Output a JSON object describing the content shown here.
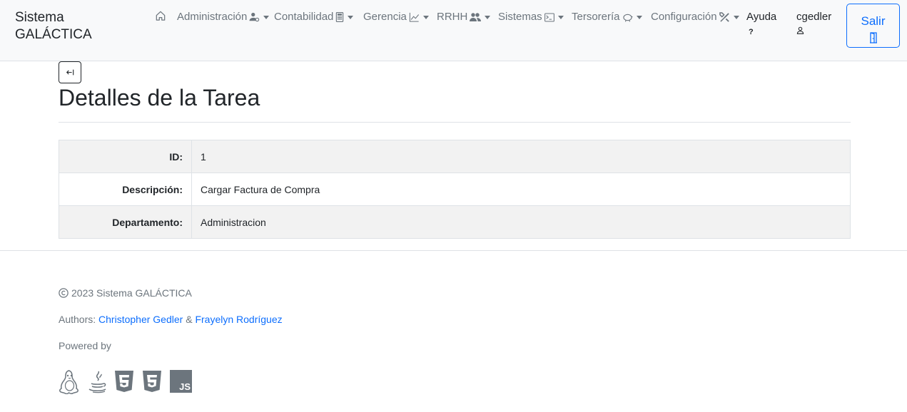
{
  "app": {
    "brand": "Sistema GALÁCTICA"
  },
  "nav": {
    "home_icon": "house-icon",
    "items": [
      {
        "label": "Administración",
        "icon": "person-gear-icon"
      },
      {
        "label": "Contabilidad",
        "icon": "calculator-icon"
      },
      {
        "label": "Gerencia",
        "icon": "graph-up-icon"
      },
      {
        "label": "RRHH",
        "icon": "people-icon"
      },
      {
        "label": "Sistemas",
        "icon": "terminal-icon"
      },
      {
        "label": "Tersorería",
        "icon": "piggy-bank-icon"
      },
      {
        "label": "Configuración",
        "icon": "tools-icon"
      }
    ],
    "help": {
      "label": "Ayuda",
      "sub": "?"
    },
    "user": {
      "label": "cgedler",
      "icon": "person-icon"
    },
    "logout": {
      "label": "Salir",
      "icon": "door-open-icon"
    }
  },
  "page": {
    "back_icon": "arrow-bar-left-icon",
    "title": "Detalles de la Tarea",
    "rows": [
      {
        "label": "ID:",
        "value": "1"
      },
      {
        "label": "Descripción:",
        "value": "Cargar Factura de Compra"
      },
      {
        "label": "Departamento:",
        "value": "Administracion"
      }
    ]
  },
  "footer": {
    "copyright": "2023 Sistema GALÁCTICA",
    "authors_prefix": "Authors:",
    "author1": "Christopher Gedler",
    "and": "&",
    "author2": "Frayelyn Rodríguez",
    "powered_by": "Powered by",
    "tech": [
      "linux-icon",
      "java-icon",
      "html5-icon",
      "css3-icon",
      "javascript-icon"
    ]
  },
  "colors": {
    "primary": "#0d6efd",
    "muted": "#6c757d",
    "navbar_bg": "#f8f9fa",
    "stripe": "#f2f2f2"
  }
}
